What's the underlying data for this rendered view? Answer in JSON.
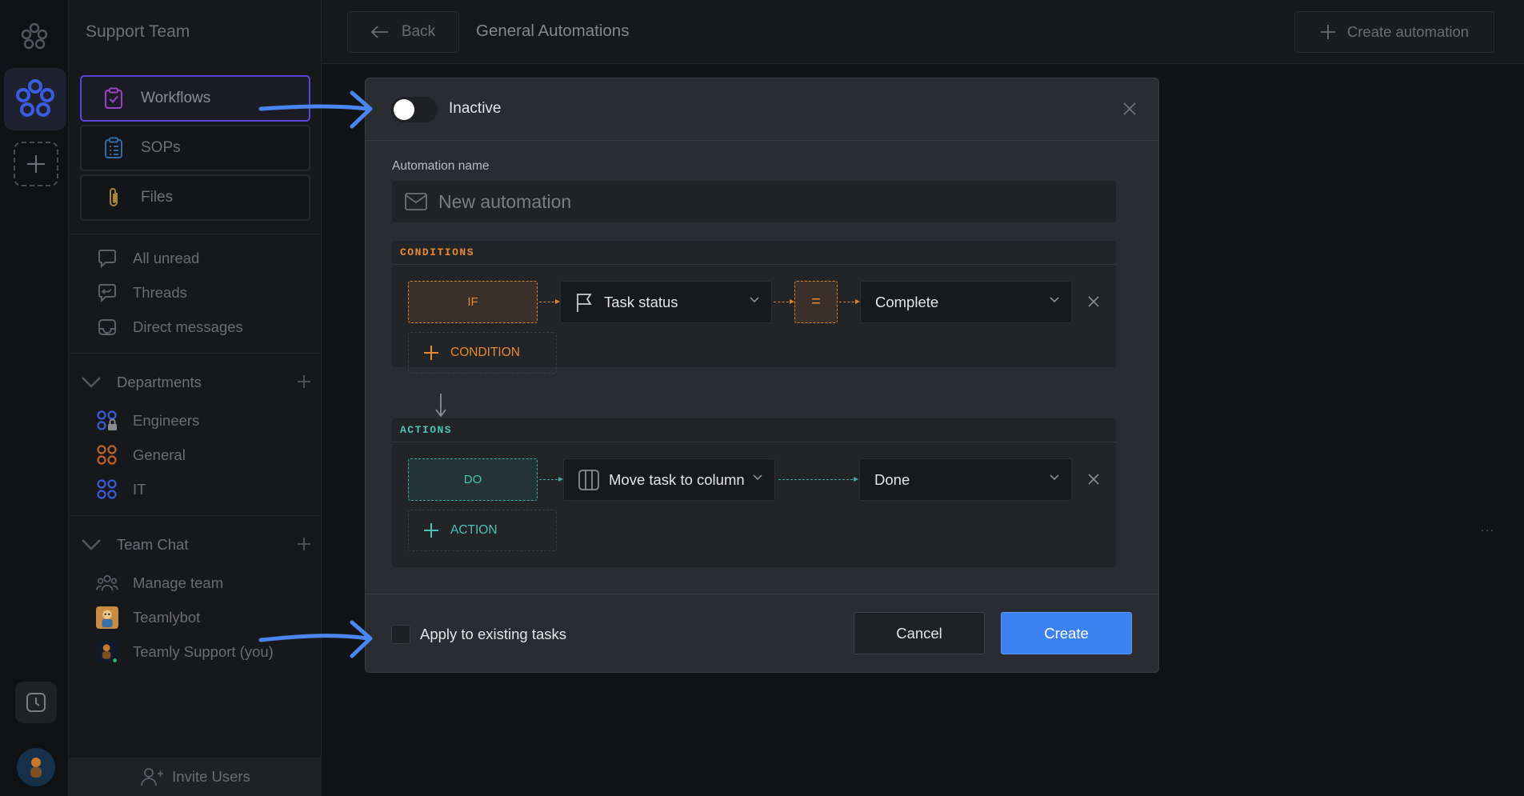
{
  "sidebar": {
    "team_name": "Support Team",
    "nav": [
      {
        "label": "Workflows",
        "icon": "clipboard-check-icon"
      },
      {
        "label": "SOPs",
        "icon": "clipboard-list-icon"
      },
      {
        "label": "Files",
        "icon": "paperclip-icon"
      }
    ],
    "inbox": [
      {
        "label": "All unread",
        "icon": "chat-bubble-icon"
      },
      {
        "label": "Threads",
        "icon": "thread-icon"
      },
      {
        "label": "Direct messages",
        "icon": "inbox-icon"
      }
    ],
    "departments": {
      "title": "Departments",
      "items": [
        {
          "label": "Engineers",
          "color": "#3b5bd6"
        },
        {
          "label": "General",
          "color": "#b9622e"
        },
        {
          "label": "IT",
          "color": "#3b5bd6"
        }
      ]
    },
    "team_chat": {
      "title": "Team Chat",
      "items": [
        {
          "label": "Manage team",
          "icon": "people-icon"
        },
        {
          "label": "Teamlybot",
          "icon": "bot-avatar"
        },
        {
          "label": "Teamly Support (you)",
          "icon": "user-avatar"
        }
      ]
    },
    "invite_label": "Invite Users"
  },
  "topbar": {
    "back_label": "Back",
    "title": "General Automations",
    "create_label": "Create automation"
  },
  "modal": {
    "toggle_label": "Inactive",
    "toggle_on": false,
    "name_label": "Automation name",
    "name_placeholder": "New automation",
    "conditions": {
      "header": "CONDITIONS",
      "if_label": "IF",
      "field": "Task status",
      "operator": "=",
      "value": "Complete",
      "add_label": "CONDITION"
    },
    "actions": {
      "header": "ACTIONS",
      "do_label": "DO",
      "action": "Move task to column",
      "value": "Done",
      "add_label": "ACTION"
    },
    "apply_label": "Apply to existing tasks",
    "apply_checked": false,
    "cancel_label": "Cancel",
    "create_label": "Create"
  },
  "colors": {
    "accent": "#3b82f0",
    "condition": "#e88a33",
    "action": "#4fc1b5",
    "callout_arrow": "#4a86f0"
  }
}
